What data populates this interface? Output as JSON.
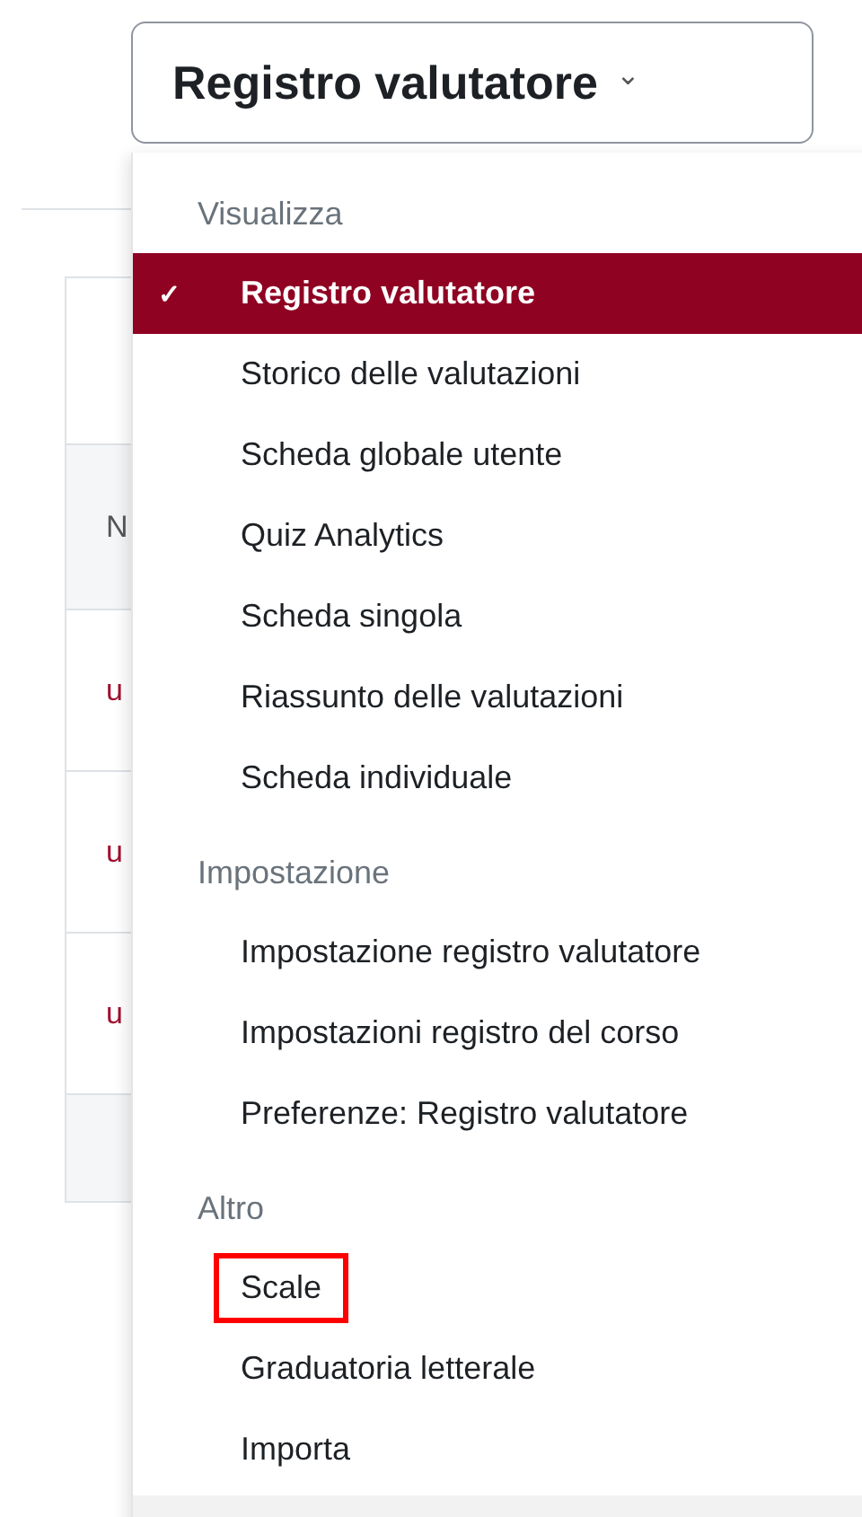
{
  "view_selector": {
    "label": "Registro valutatore",
    "caret": "⌄"
  },
  "table": {
    "header": "N",
    "rows": [
      {
        "cell": "u"
      },
      {
        "cell": "u"
      },
      {
        "cell": "u"
      }
    ]
  },
  "menu": {
    "sections": [
      {
        "heading": "Visualizza",
        "items": [
          {
            "label": "Registro valutatore",
            "selected": true,
            "check": "✓",
            "annotated": false
          },
          {
            "label": "Storico delle valutazioni",
            "selected": false,
            "annotated": false
          },
          {
            "label": "Scheda globale utente",
            "selected": false,
            "annotated": false
          },
          {
            "label": "Quiz Analytics",
            "selected": false,
            "annotated": false
          },
          {
            "label": "Scheda singola",
            "selected": false,
            "annotated": false
          },
          {
            "label": "Riassunto delle valutazioni",
            "selected": false,
            "annotated": false
          },
          {
            "label": "Scheda individuale",
            "selected": false,
            "annotated": false
          }
        ]
      },
      {
        "heading": "Impostazione",
        "items": [
          {
            "label": "Impostazione registro valutatore",
            "selected": false,
            "annotated": false
          },
          {
            "label": "Impostazioni registro del corso",
            "selected": false,
            "annotated": false
          },
          {
            "label": "Preferenze: Registro valutatore",
            "selected": false,
            "annotated": false
          }
        ]
      },
      {
        "heading": "Altro",
        "items": [
          {
            "label": "Scale",
            "selected": false,
            "annotated": true
          },
          {
            "label": "Graduatoria letterale",
            "selected": false,
            "annotated": false
          },
          {
            "label": "Importa",
            "selected": false,
            "annotated": false
          }
        ]
      }
    ]
  }
}
